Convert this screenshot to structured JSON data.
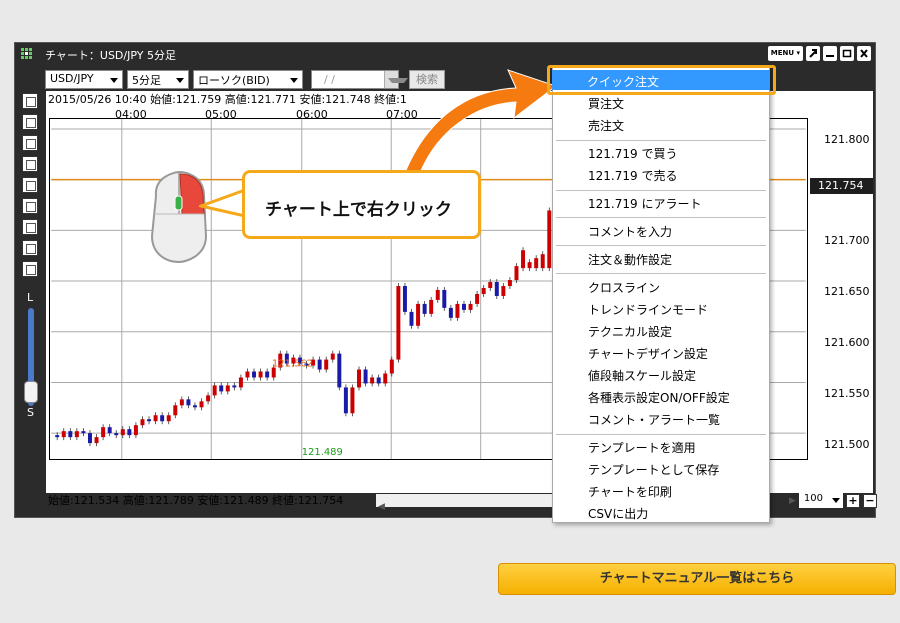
{
  "window": {
    "title": "チャート：USD/JPY 5分足",
    "menu_label": "MENU"
  },
  "toolbar": {
    "pair": "USD/JPY",
    "timeframe": "5分足",
    "chart_type": "ローソク(BID)",
    "date_value": "/ /",
    "search_label": "検索"
  },
  "info": {
    "top": "2015/05/26 10:40  始値:121.759     高値:121.771     安値:121.748     終値:1",
    "bottom": "始値:121.534     高値:121.789     安値:121.489     終値:121.754"
  },
  "time_labels": [
    "04:00",
    "05:00",
    "06:00",
    "07:00"
  ],
  "price_labels": [
    "121.800",
    "121.700",
    "121.650",
    "121.600",
    "121.550",
    "121.500"
  ],
  "current_price": "121.754",
  "annotations": {
    "high": "121.562",
    "low": "121.489"
  },
  "slider": {
    "top_label": "L",
    "bottom_label": "S"
  },
  "zoom": {
    "value": "100"
  },
  "context_menu": {
    "highlighted": "クイック注文",
    "items": [
      "買注文",
      "売注文",
      "121.719 で買う",
      "121.719 で売る",
      "121.719 にアラート",
      "コメントを入力",
      "注文＆動作設定",
      "クロスライン",
      "トレンドラインモード",
      "テクニカル設定",
      "チャートデザイン設定",
      "値段軸スケール設定",
      "各種表示設定ON/OFF設定",
      "コメント・アラート一覧",
      "テンプレートを適用",
      "テンプレートとして保存",
      "チャートを印刷",
      "CSVに出力"
    ]
  },
  "callout": {
    "text": "チャート上で右クリック"
  },
  "cta": {
    "label": "チャートマニュアル一覧はこちら"
  },
  "colors": {
    "accent_orange": "#f5a81a",
    "arrow_orange": "#f57a10",
    "up": "#cc0000",
    "down": "#1a1aa8",
    "menu_highlight": "#3399ff"
  }
}
